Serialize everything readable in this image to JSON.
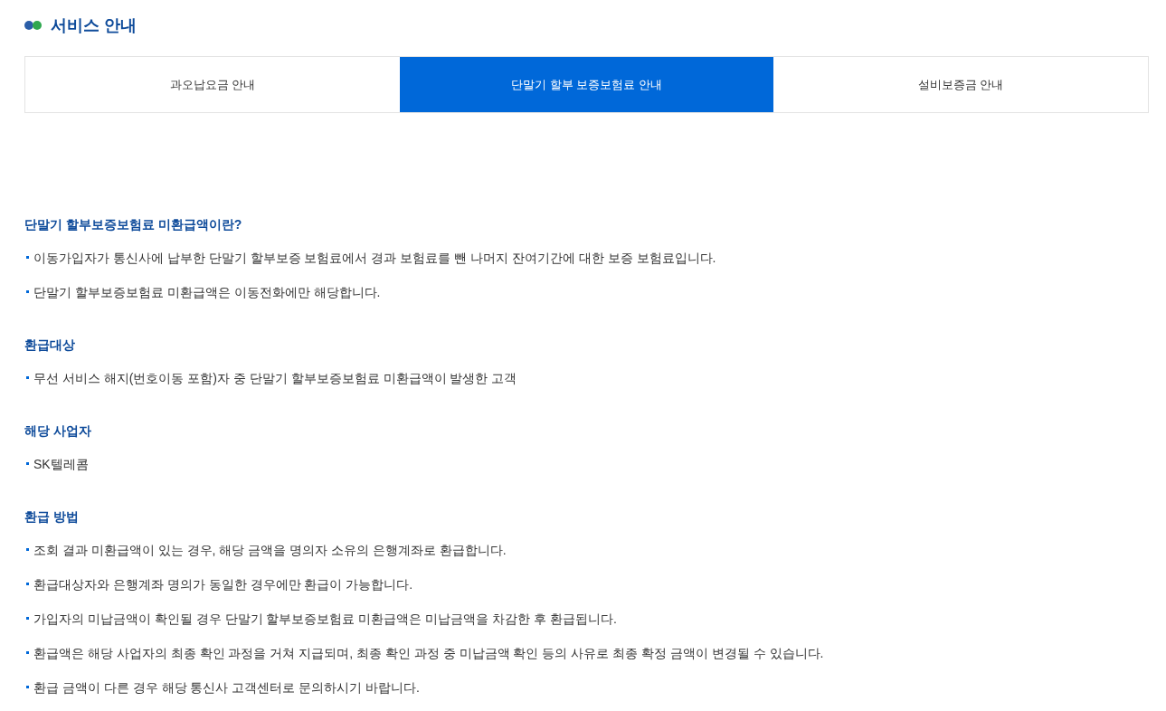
{
  "page_title": "서비스 안내",
  "tabs": [
    {
      "label": "과오납요금 안내",
      "selected": false
    },
    {
      "label": "단말기 할부 보증보험료 안내",
      "selected": true
    },
    {
      "label": "설비보증금 안내",
      "selected": false
    }
  ],
  "sections": [
    {
      "heading": "단말기 할부보증보험료 미환급액이란?",
      "items": [
        "이동가입자가 통신사에 납부한 단말기 할부보증 보험료에서 경과 보험료를 뺀 나머지 잔여기간에 대한 보증 보험료입니다.",
        "단말기 할부보증보험료 미환급액은 이동전화에만 해당합니다."
      ]
    },
    {
      "heading": "환급대상",
      "items": [
        "무선 서비스 해지(번호이동 포함)자 중 단말기 할부보증보험료 미환급액이 발생한 고객"
      ]
    },
    {
      "heading": "해당 사업자",
      "items": [
        "SK텔레콤"
      ]
    },
    {
      "heading": "환급 방법",
      "items": [
        "조회 결과 미환급액이 있는 경우, 해당 금액을 명의자 소유의 은행계좌로 환급합니다.",
        "환급대상자와 은행계좌 명의가 동일한 경우에만 환급이 가능합니다.",
        "가입자의 미납금액이 확인될 경우 단말기 할부보증보험료 미환급액은 미납금액을 차감한 후 환급됩니다.",
        "환급액은 해당 사업자의 최종 확인 과정을 거쳐 지급되며, 최종 확인 과정 중 미납금액 확인 등의 사유로 최종 확정 금액이 변경될 수 있습니다.",
        "환급 금액이 다른 경우 해당 통신사 고객센터로 문의하시기 바랍니다."
      ]
    }
  ]
}
